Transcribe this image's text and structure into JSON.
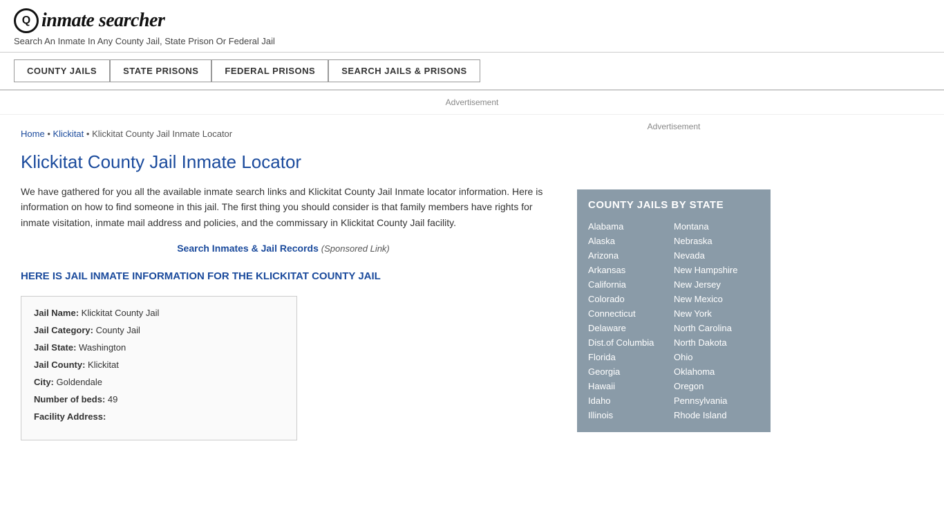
{
  "header": {
    "logo_symbol": "Q",
    "logo_text": "inmate searcher",
    "tagline": "Search An Inmate In Any County Jail, State Prison Or Federal Jail"
  },
  "nav": {
    "buttons": [
      {
        "label": "COUNTY JAILS",
        "name": "county-jails-nav"
      },
      {
        "label": "STATE PRISONS",
        "name": "state-prisons-nav"
      },
      {
        "label": "FEDERAL PRISONS",
        "name": "federal-prisons-nav"
      },
      {
        "label": "SEARCH JAILS & PRISONS",
        "name": "search-jails-nav"
      }
    ]
  },
  "ad_bar": {
    "label": "Advertisement"
  },
  "breadcrumb": {
    "home": "Home",
    "klickitat": "Klickitat",
    "current": "Klickitat County Jail Inmate Locator"
  },
  "page_title": "Klickitat County Jail Inmate Locator",
  "body_text": "We have gathered for you all the available inmate search links and Klickitat County Jail Inmate locator information. Here is information on how to find someone in this jail. The first thing you should consider is that family members have rights for inmate visitation, inmate mail address and policies, and the commissary in Klickitat County Jail facility.",
  "sponsored": {
    "link_text": "Search Inmates & Jail Records",
    "note": "(Sponsored Link)"
  },
  "section_heading": "HERE IS JAIL INMATE INFORMATION FOR THE KLICKITAT COUNTY JAIL",
  "info_box": {
    "jail_name_label": "Jail Name:",
    "jail_name": "Klickitat County Jail",
    "jail_category_label": "Jail Category:",
    "jail_category": "County Jail",
    "jail_state_label": "Jail State:",
    "jail_state": "Washington",
    "jail_county_label": "Jail County:",
    "jail_county": "Klickitat",
    "city_label": "City:",
    "city": "Goldendale",
    "beds_label": "Number of beds:",
    "beds": "49",
    "facility_address_label": "Facility Address:"
  },
  "sidebar": {
    "ad_label": "Advertisement",
    "state_box_title": "COUNTY JAILS BY STATE",
    "states_left": [
      "Alabama",
      "Alaska",
      "Arizona",
      "Arkansas",
      "California",
      "Colorado",
      "Connecticut",
      "Delaware",
      "Dist.of Columbia",
      "Florida",
      "Georgia",
      "Hawaii",
      "Idaho",
      "Illinois"
    ],
    "states_right": [
      "Montana",
      "Nebraska",
      "Nevada",
      "New Hampshire",
      "New Jersey",
      "New Mexico",
      "New York",
      "North Carolina",
      "North Dakota",
      "Ohio",
      "Oklahoma",
      "Oregon",
      "Pennsylvania",
      "Rhode Island"
    ]
  }
}
